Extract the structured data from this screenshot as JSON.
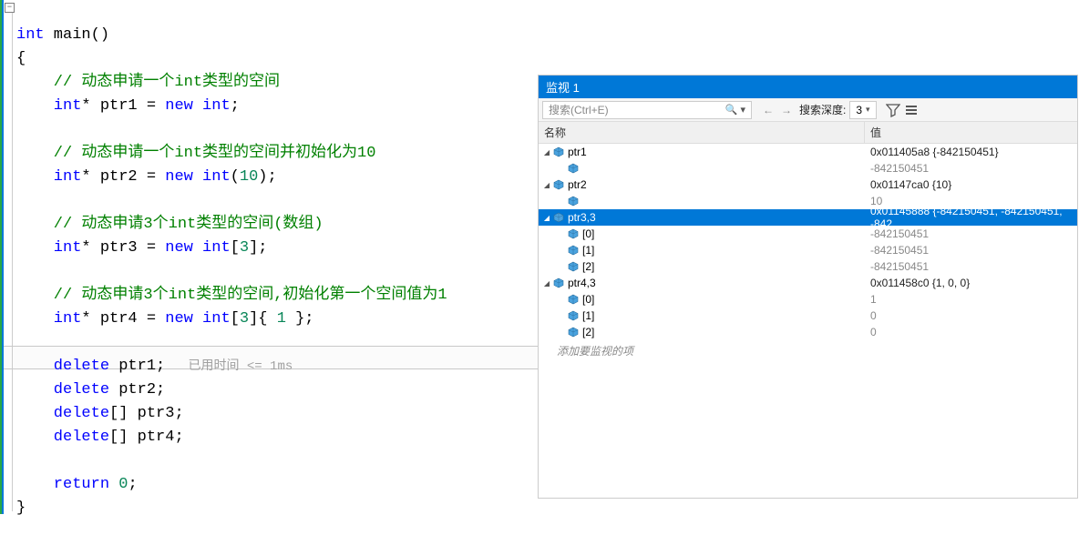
{
  "code": {
    "line1_int": "int",
    "line1_main": " main()",
    "line2": "{",
    "cmt1": "    // 动态申请一个int类型的空间",
    "decl1_a": "    int",
    "decl1_b": "* ptr1 = ",
    "decl1_c": "new",
    "decl1_d": " int",
    "decl1_e": ";",
    "cmt2": "    // 动态申请一个int类型的空间并初始化为10",
    "decl2_a": "    int",
    "decl2_b": "* ptr2 = ",
    "decl2_c": "new",
    "decl2_d": " int",
    "decl2_e": "(",
    "decl2_num": "10",
    "decl2_f": ");",
    "cmt3": "    // 动态申请3个int类型的空间(数组)",
    "decl3_a": "    int",
    "decl3_b": "* ptr3 = ",
    "decl3_c": "new",
    "decl3_d": " int",
    "decl3_e": "[",
    "decl3_num": "3",
    "decl3_f": "];",
    "cmt4": "    // 动态申请3个int类型的空间,初始化第一个空间值为1",
    "decl4_a": "    int",
    "decl4_b": "* ptr4 = ",
    "decl4_c": "new",
    "decl4_d": " int",
    "decl4_e": "[",
    "decl4_num1": "3",
    "decl4_f": "]{ ",
    "decl4_num2": "1",
    "decl4_g": " };",
    "del1_a": "    delete",
    "del1_b": " ptr1;",
    "perf": "   已用时间 <= 1ms",
    "del2_a": "    delete",
    "del2_b": " ptr2;",
    "del3_a": "    delete",
    "del3_b": "[] ptr3;",
    "del4_a": "    delete",
    "del4_b": "[] ptr4;",
    "ret_a": "    return",
    "ret_b": " ",
    "ret_num": "0",
    "ret_c": ";",
    "close": "}"
  },
  "watch": {
    "title": "监视 1",
    "search_placeholder": "搜索(Ctrl+E)",
    "depth_label": "搜索深度:",
    "depth_value": "3",
    "hdr_name": "名称",
    "hdr_value": "值",
    "add_item": "添加要监视的项",
    "rows": [
      {
        "indent": 0,
        "exp": "▢",
        "name": "ptr1",
        "value": "0x011405a8 {-842150451}",
        "vclass": "val-dark"
      },
      {
        "indent": 1,
        "exp": "",
        "name": "",
        "value": "-842150451"
      },
      {
        "indent": 0,
        "exp": "▢",
        "name": "ptr2",
        "value": "0x01147ca0 {10}",
        "vclass": "val-dark"
      },
      {
        "indent": 1,
        "exp": "",
        "name": "",
        "value": "10"
      },
      {
        "indent": 0,
        "exp": "▢",
        "name": "ptr3,3",
        "value": "0x01145888 {-842150451, -842150451, -842",
        "sel": true,
        "vclass": "val-dark"
      },
      {
        "indent": 1,
        "exp": "",
        "name": "[0]",
        "value": "-842150451"
      },
      {
        "indent": 1,
        "exp": "",
        "name": "[1]",
        "value": "-842150451"
      },
      {
        "indent": 1,
        "exp": "",
        "name": "[2]",
        "value": "-842150451"
      },
      {
        "indent": 0,
        "exp": "▢",
        "name": "ptr4,3",
        "value": "0x011458c0 {1, 0, 0}",
        "vclass": "val-dark"
      },
      {
        "indent": 1,
        "exp": "",
        "name": "[0]",
        "value": "1"
      },
      {
        "indent": 1,
        "exp": "",
        "name": "[1]",
        "value": "0"
      },
      {
        "indent": 1,
        "exp": "",
        "name": "[2]",
        "value": "0"
      }
    ]
  }
}
